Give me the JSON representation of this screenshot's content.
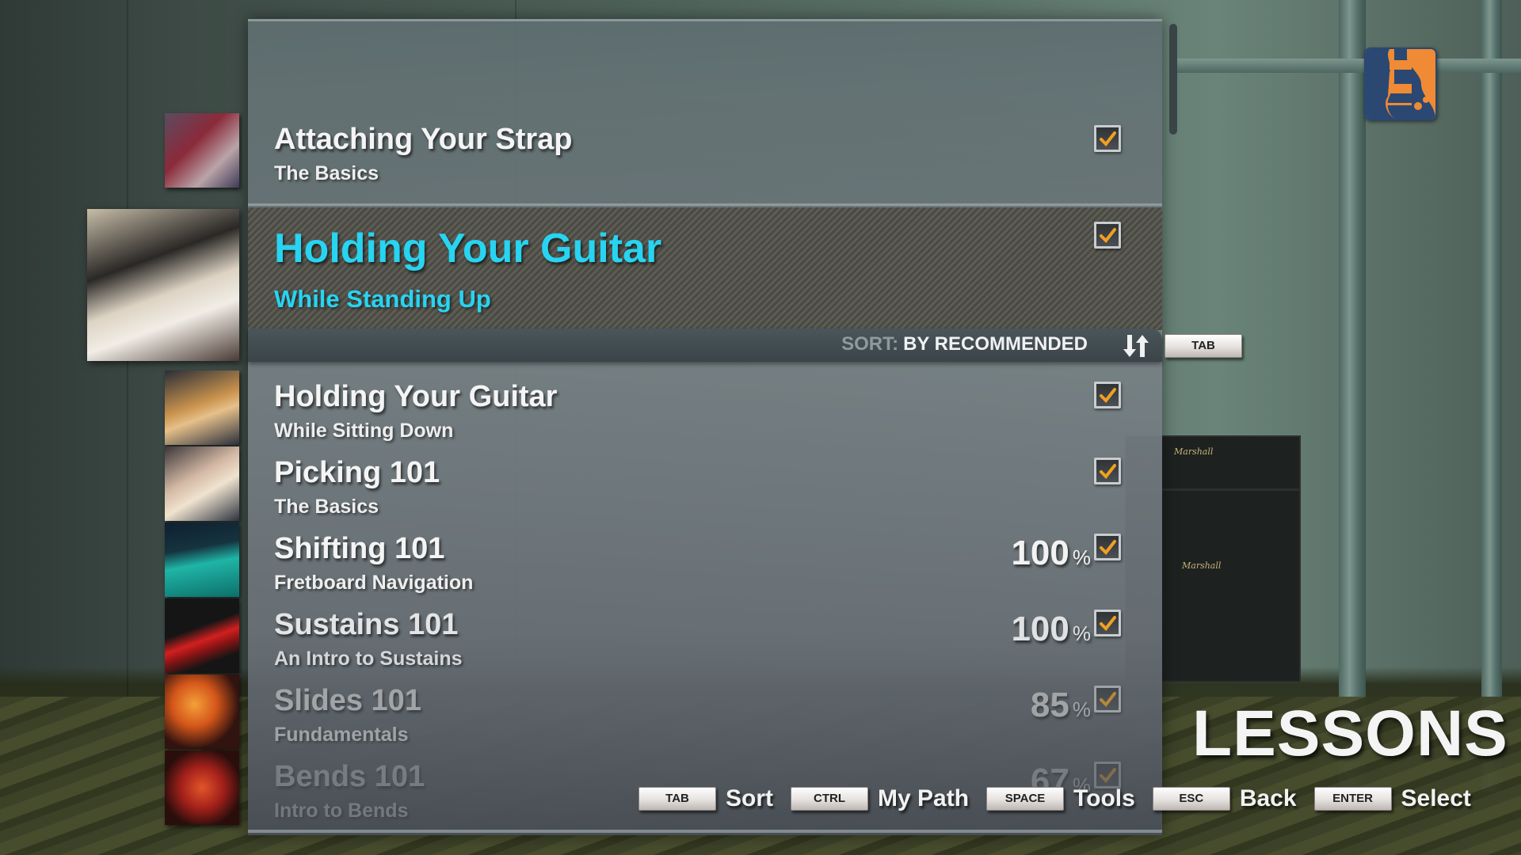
{
  "screen": {
    "title": "LESSONS",
    "app_icon": "electric-guitar-icon"
  },
  "sort": {
    "prefix": "SORT:",
    "value": "BY RECOMMENDED",
    "icon": "sort-arrows-icon",
    "key": "TAB"
  },
  "lessons": [
    {
      "title": "Attaching Your Strap",
      "subtitle": "The Basics",
      "percent": null,
      "completed": true,
      "thumbnail": "guitarist-red-guitar-photo"
    },
    {
      "title": "Holding Your Guitar",
      "subtitle": "While Standing Up",
      "percent": null,
      "completed": true,
      "selected": true,
      "thumbnail": "guitarist-standing-white-guitar-photo"
    },
    {
      "title": "Holding Your Guitar",
      "subtitle": "While Sitting Down",
      "percent": null,
      "completed": true,
      "thumbnail": "guitarist-sitting-photo"
    },
    {
      "title": "Picking 101",
      "subtitle": "The Basics",
      "percent": null,
      "completed": true,
      "thumbnail": "picking-hand-photo"
    },
    {
      "title": "Shifting 101",
      "subtitle": "Fretboard Navigation",
      "percent": "100",
      "completed": true,
      "thumbnail": "teal-fretboard-graphic"
    },
    {
      "title": "Sustains 101",
      "subtitle": "An Intro to Sustains",
      "percent": "100",
      "completed": true,
      "thumbnail": "red-sustain-note-graphic"
    },
    {
      "title": "Slides 101",
      "subtitle": "Fundamentals",
      "percent": "85",
      "completed": true,
      "thumbnail": "orange-slide-graphic"
    },
    {
      "title": "Bends 101",
      "subtitle": "Intro to Bends",
      "percent": "67",
      "completed": true,
      "thumbnail": "red-bend-graphic"
    }
  ],
  "percent_symbol": "%",
  "hints": [
    {
      "key": "TAB",
      "label": "Sort"
    },
    {
      "key": "CTRL",
      "label": "My Path"
    },
    {
      "key": "SPACE",
      "label": "Tools"
    },
    {
      "key": "ESC",
      "label": "Back"
    },
    {
      "key": "ENTER",
      "label": "Select"
    }
  ],
  "colors": {
    "selected_text": "#27d4f1",
    "checkmark": "#f0a020",
    "app_icon_orange": "#f08a35",
    "app_icon_blue": "#2a4872"
  }
}
